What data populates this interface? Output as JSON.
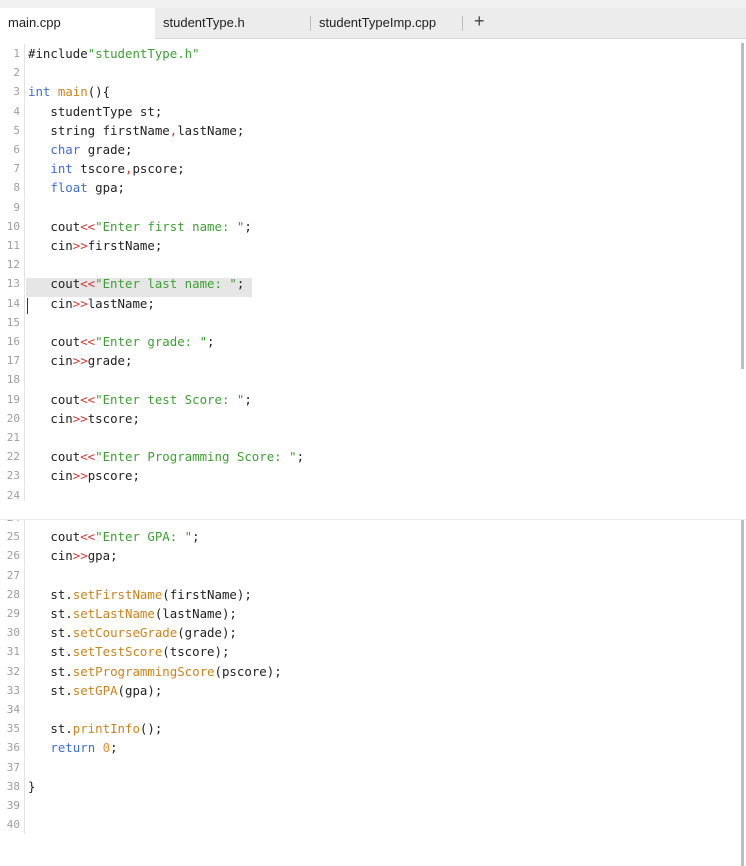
{
  "tabs": [
    {
      "label": "main.cpp",
      "active": true
    },
    {
      "label": "studentType.h",
      "active": false
    },
    {
      "label": "studentTypeImp.cpp",
      "active": false
    }
  ],
  "add_tab_label": "+",
  "panel_top": {
    "lines": [
      {
        "n": "1",
        "code": "#include\"studentType.h\""
      },
      {
        "n": "2",
        "code": ""
      },
      {
        "n": "3",
        "code": "int main(){"
      },
      {
        "n": "4",
        "code": "   studentType st;"
      },
      {
        "n": "5",
        "code": "   string firstName,lastName;"
      },
      {
        "n": "6",
        "code": "   char grade;"
      },
      {
        "n": "7",
        "code": "   int tscore,pscore;"
      },
      {
        "n": "8",
        "code": "   float gpa;"
      },
      {
        "n": "9",
        "code": ""
      },
      {
        "n": "10",
        "code": "   cout<<\"Enter first name: \";"
      },
      {
        "n": "11",
        "code": "   cin>>firstName;"
      },
      {
        "n": "12",
        "code": ""
      },
      {
        "n": "13",
        "code": "   cout<<\"Enter last name: \";"
      },
      {
        "n": "14",
        "code": "   cin>>lastName;"
      },
      {
        "n": "15",
        "code": ""
      },
      {
        "n": "16",
        "code": "   cout<<\"Enter grade: \";"
      },
      {
        "n": "17",
        "code": "   cin>>grade;"
      },
      {
        "n": "18",
        "code": ""
      },
      {
        "n": "19",
        "code": "   cout<<\"Enter test Score: \";"
      },
      {
        "n": "20",
        "code": "   cin>>tscore;"
      },
      {
        "n": "21",
        "code": ""
      },
      {
        "n": "22",
        "code": "   cout<<\"Enter Programming Score: \";"
      },
      {
        "n": "23",
        "code": "   cin>>pscore;"
      },
      {
        "n": "24",
        "code": ""
      }
    ]
  },
  "panel_bottom": {
    "lines": [
      {
        "n": "24",
        "code": ""
      },
      {
        "n": "25",
        "code": "   cout<<\"Enter GPA: \";"
      },
      {
        "n": "26",
        "code": "   cin>>gpa;"
      },
      {
        "n": "27",
        "code": ""
      },
      {
        "n": "28",
        "code": "   st.setFirstName(firstName);"
      },
      {
        "n": "29",
        "code": "   st.setLastName(lastName);"
      },
      {
        "n": "30",
        "code": "   st.setCourseGrade(grade);"
      },
      {
        "n": "31",
        "code": "   st.setTestScore(tscore);"
      },
      {
        "n": "32",
        "code": "   st.setProgrammingScore(pscore);"
      },
      {
        "n": "33",
        "code": "   st.setGPA(gpa);"
      },
      {
        "n": "34",
        "code": ""
      },
      {
        "n": "35",
        "code": "   st.printInfo();"
      },
      {
        "n": "36",
        "code": "   return 0;"
      },
      {
        "n": "37",
        "code": ""
      },
      {
        "n": "38",
        "code": "}"
      },
      {
        "n": "39",
        "code": ""
      },
      {
        "n": "40",
        "code": ""
      }
    ]
  },
  "selected_line": "13",
  "caret_line": "14",
  "colors": {
    "keyword": "#3e6fd1",
    "string": "#3f9f35",
    "method": "#c9851c",
    "operator": "#d2372f",
    "number": "#e0943c"
  }
}
